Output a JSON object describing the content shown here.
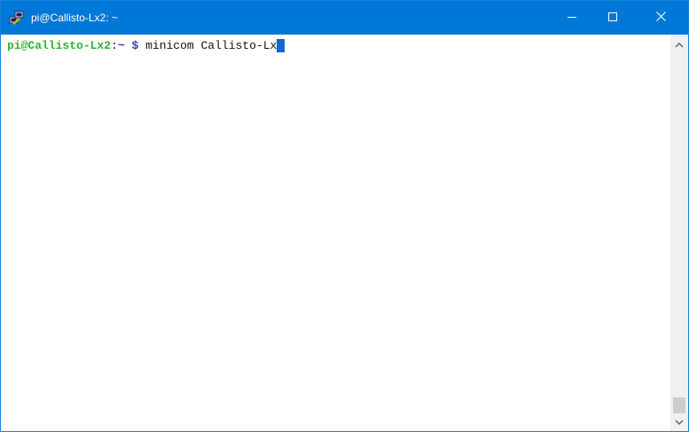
{
  "window": {
    "title": "pi@Callisto-Lx2: ~",
    "app_icon": "putty-icon",
    "controls": {
      "minimize": "minimize-icon",
      "maximize": "maximize-icon",
      "close": "close-icon"
    }
  },
  "terminal": {
    "prompt_user": "pi@Callisto-Lx2",
    "prompt_sep": ":",
    "prompt_path": "~",
    "prompt_dollar": "$",
    "command": "minicom Callisto-Lx"
  },
  "scrollbar": {
    "up_icon": "chevron-up-icon",
    "down_icon": "chevron-down-icon",
    "position": 1.0
  },
  "colors": {
    "titlebar": "#0078d7",
    "prompt_user": "#2db52d",
    "prompt_path": "#3a3ab8",
    "cursor": "#1464d2"
  }
}
